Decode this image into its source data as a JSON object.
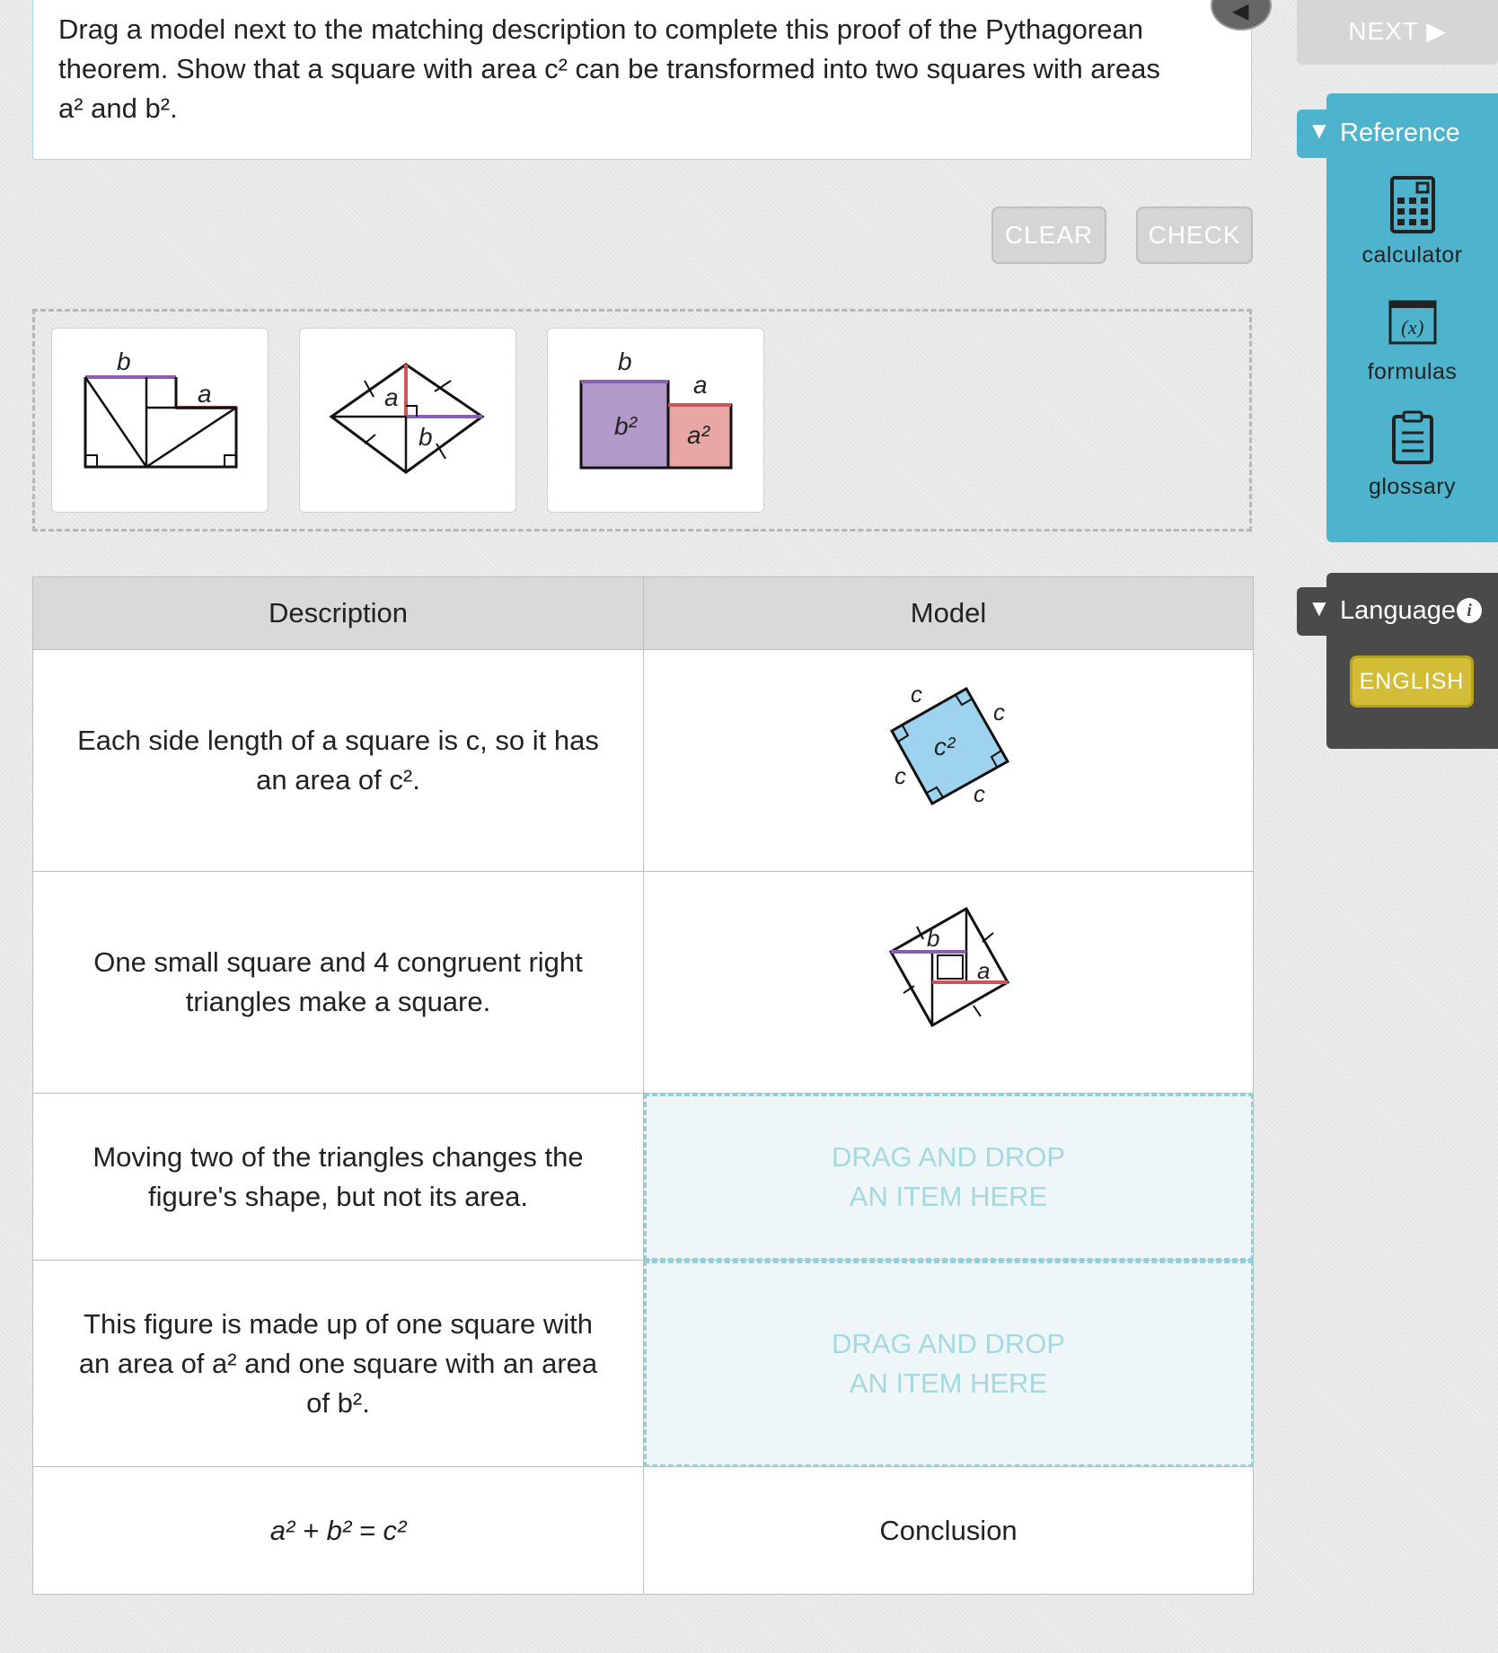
{
  "prompt": {
    "line1": "Drag a model next to the matching description to complete this proof of the Pythagorean",
    "line2": "theorem. Show that a square with area c² can be transformed into two squares with areas",
    "line3": "a² and b²."
  },
  "toolbar": {
    "next_label": "NEXT ▶",
    "clear_label": "CLEAR",
    "check_label": "CHECK"
  },
  "bank": {
    "tile1": {
      "label_b": "b",
      "label_a": "a"
    },
    "tile2": {
      "label_a": "a",
      "label_b": "b"
    },
    "tile3": {
      "label_b": "b",
      "label_a": "a",
      "area_b": "b²",
      "area_a": "a²"
    }
  },
  "table": {
    "headers": [
      "Description",
      "Model"
    ],
    "rows": [
      {
        "desc": [
          "Each side length of a square is c, so it has",
          "an area of c²."
        ],
        "model_type": "figure",
        "figure": {
          "side": "c",
          "area": "c²"
        }
      },
      {
        "desc": [
          "One small square and 4 congruent right",
          "triangles make a square."
        ],
        "model_type": "figure",
        "figure": {
          "label_b": "b",
          "label_a": "a"
        }
      },
      {
        "desc": [
          "Moving two of the triangles changes the",
          "figure's shape, but not its area."
        ],
        "model_type": "drop",
        "drop": [
          "DRAG AND DROP",
          "AN ITEM HERE"
        ]
      },
      {
        "desc": [
          "This figure is made up of one square with",
          "an area of a² and one square with an area",
          "of b²."
        ],
        "model_type": "drop",
        "drop": [
          "DRAG AND DROP",
          "AN ITEM HERE"
        ]
      },
      {
        "desc": [
          "a² + b² = c²"
        ],
        "model_type": "text",
        "model_text": "Conclusion"
      }
    ]
  },
  "sidebar": {
    "reference_label": "Reference",
    "tools": [
      {
        "label": "calculator",
        "icon": "calculator-icon"
      },
      {
        "label": "formulas",
        "icon": "formulas-icon",
        "glyph": "(x)"
      },
      {
        "label": "glossary",
        "icon": "clipboard-icon"
      }
    ],
    "language_label": "Language",
    "language_value": "ENGLISH"
  },
  "colors": {
    "accent": "#4eb3cc",
    "purple": "#b19ac9",
    "pink": "#e8a7a4",
    "light_blue": "#9dd3ef",
    "drop_text": "#a5d8e0"
  }
}
